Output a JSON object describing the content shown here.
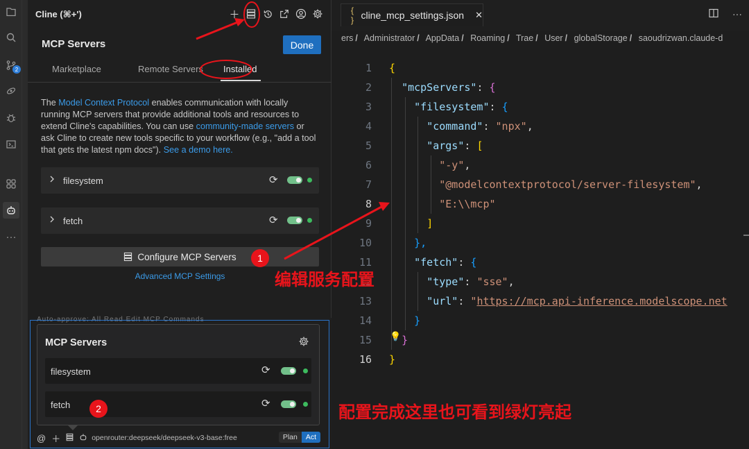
{
  "panel": {
    "title": "Cline (⌘+')",
    "mcp_title": "MCP Servers",
    "done_label": "Done",
    "tabs": [
      "Marketplace",
      "Remote Servers",
      "Installed"
    ],
    "description": {
      "part1": "The ",
      "link1": "Model Context Protocol",
      "part2": " enables communication with locally running MCP servers that provide additional tools and resources to extend Cline's capabilities. You can use ",
      "link2": "community-made servers",
      "part3": " or ask Cline to create new tools specific to your workflow (e.g., \"add a tool that gets the latest npm docs\"). ",
      "link3": "See a demo here."
    },
    "servers": [
      {
        "name": "filesystem",
        "enabled": true,
        "status_color": "#3dbb5e"
      },
      {
        "name": "fetch",
        "enabled": true,
        "status_color": "#3dbb5e"
      }
    ],
    "configure_label": "Configure MCP Servers",
    "advanced_label": "Advanced MCP Settings"
  },
  "popup": {
    "title": "MCP Servers",
    "servers": [
      {
        "name": "filesystem",
        "enabled": true
      },
      {
        "name": "fetch",
        "enabled": true
      }
    ],
    "ghost_text": "Auto-approve:   All   Read   Edit   MCP Commands"
  },
  "bottom_bar": {
    "model": "openrouter:deepseek/deepseek-v3-base:free",
    "plan_label": "Plan",
    "act_label": "Act"
  },
  "editor": {
    "tab_title": "cline_mcp_settings.json",
    "breadcrumbs": [
      "ers",
      "Administrator",
      "AppData",
      "Roaming",
      "Trae",
      "User",
      "globalStorage",
      "saoudrizwan.claude-d"
    ],
    "line_numbers": [
      "1",
      "2",
      "3",
      "4",
      "5",
      "6",
      "7",
      "8",
      "9",
      "10",
      "11",
      "12",
      "13",
      "14",
      "15",
      "16"
    ],
    "code": {
      "l1_open": "{",
      "l2_key": "\"mcpServers\"",
      "l3_key": "\"filesystem\"",
      "l4_key": "\"command\"",
      "l4_val": "\"npx\"",
      "l5_key": "\"args\"",
      "l6_val": "\"-y\"",
      "l7_val": "\"@modelcontextprotocol/server-filesystem\"",
      "l8_val": "\"E:\\\\mcp\"",
      "l9_close": "]",
      "l10_close": "},",
      "l11_key": "\"fetch\"",
      "l12_key": "\"type\"",
      "l12_val": "\"sse\"",
      "l13_key": "\"url\"",
      "l13_quote": "\"",
      "l13_url": "https://mcp.api-inference.modelscope.net",
      "l14_close": "}",
      "l15_close": "}",
      "l16_close": "}"
    }
  },
  "annotations": {
    "badge1": "1",
    "badge2": "2",
    "text1": "编辑服务配置",
    "text2": "配置完成这里也可看到绿灯亮起",
    "color": "#e8141b"
  },
  "colors": {
    "accent": "#1f6fbf",
    "link": "#3b9be8",
    "toggle_on": "#72c08a",
    "status_dot": "#3dbb5e"
  },
  "icons": {
    "activity": [
      "files-icon",
      "search-icon",
      "source-control-icon",
      "remote-explorer-icon",
      "debug-icon",
      "terminal-icon",
      "extensions-icon",
      "cline-icon",
      "more-icon"
    ],
    "header": [
      "plus-icon",
      "mcp-servers-icon",
      "history-icon",
      "popout-icon",
      "account-icon",
      "settings-icon"
    ]
  }
}
